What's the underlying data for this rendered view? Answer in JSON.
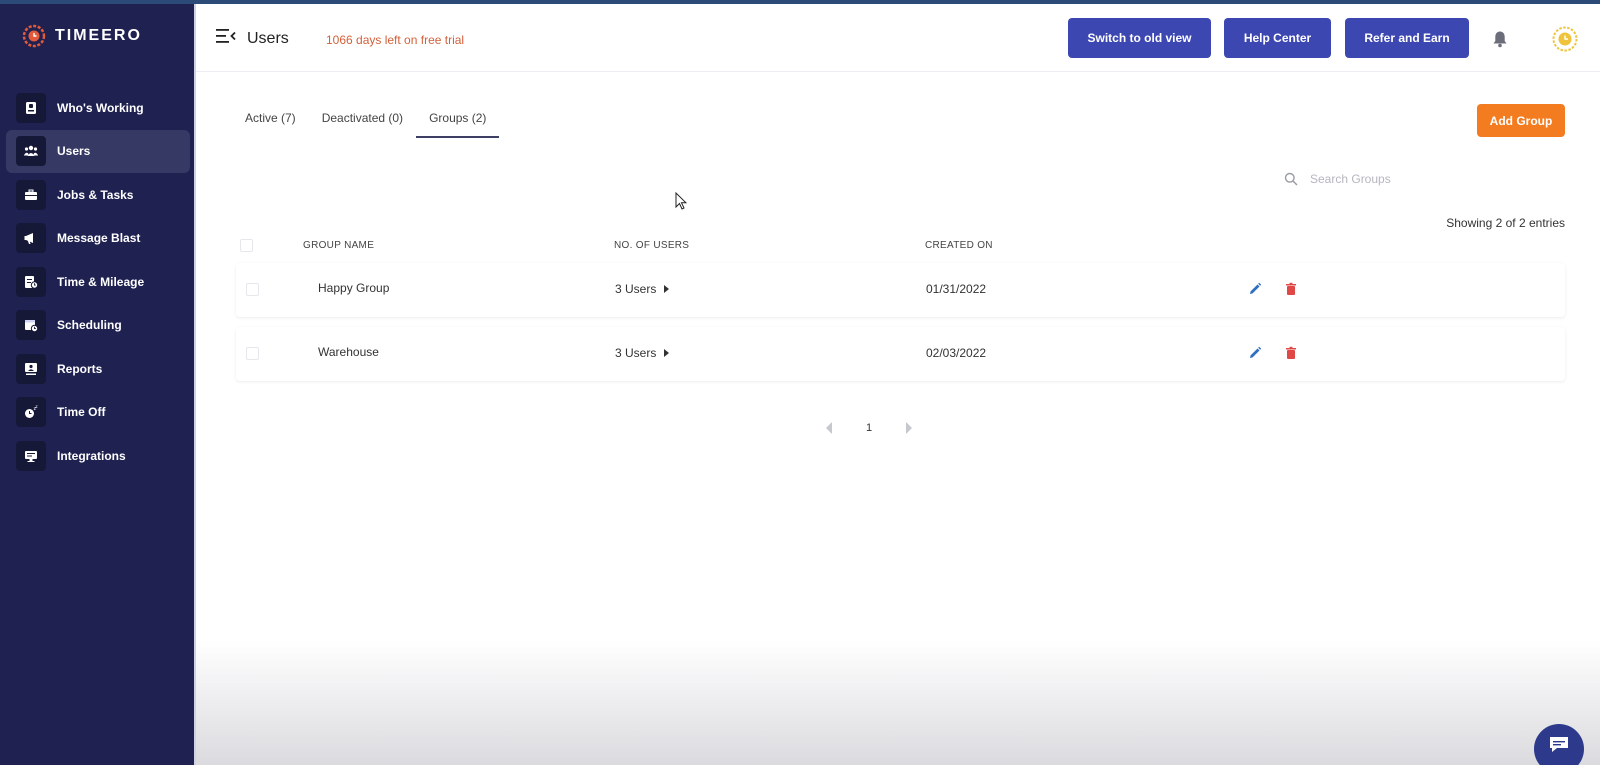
{
  "app": {
    "brand": "TIMEERO"
  },
  "sidebar": {
    "items": [
      {
        "label": "Who's Working",
        "icon": "id-badge-icon"
      },
      {
        "label": "Users",
        "icon": "users-icon",
        "active": true
      },
      {
        "label": "Jobs & Tasks",
        "icon": "briefcase-icon"
      },
      {
        "label": "Message Blast",
        "icon": "megaphone-icon"
      },
      {
        "label": "Time & Mileage",
        "icon": "timesheet-icon"
      },
      {
        "label": "Scheduling",
        "icon": "calendar-clock-icon"
      },
      {
        "label": "Reports",
        "icon": "report-icon"
      },
      {
        "label": "Time Off",
        "icon": "time-off-icon"
      },
      {
        "label": "Integrations",
        "icon": "monitor-icon"
      }
    ]
  },
  "header": {
    "title": "Users",
    "trial": "1066 days left on free trial",
    "switch_old": "Switch to old view",
    "help": "Help Center",
    "refer": "Refer and Earn"
  },
  "tabs": [
    {
      "label": "Active (7)"
    },
    {
      "label": "Deactivated (0)"
    },
    {
      "label": "Groups (2)",
      "active": true
    }
  ],
  "actions": {
    "add_group": "Add Group"
  },
  "search": {
    "placeholder": "Search Groups"
  },
  "table": {
    "showing": "Showing 2 of 2 entries",
    "columns": [
      "GROUP NAME",
      "NO. OF USERS",
      "CREATED ON"
    ],
    "rows": [
      {
        "name": "Happy Group",
        "users": "3 Users",
        "created": "01/31/2022"
      },
      {
        "name": "Warehouse",
        "users": "3 Users",
        "created": "02/03/2022"
      }
    ]
  },
  "pagination": {
    "current": "1"
  },
  "colors": {
    "sidebar": "#1f2151",
    "primary": "#3d47b2",
    "accent": "#f47c20",
    "trial": "#d2603a",
    "edit": "#2f6fc0",
    "delete": "#e04848"
  }
}
